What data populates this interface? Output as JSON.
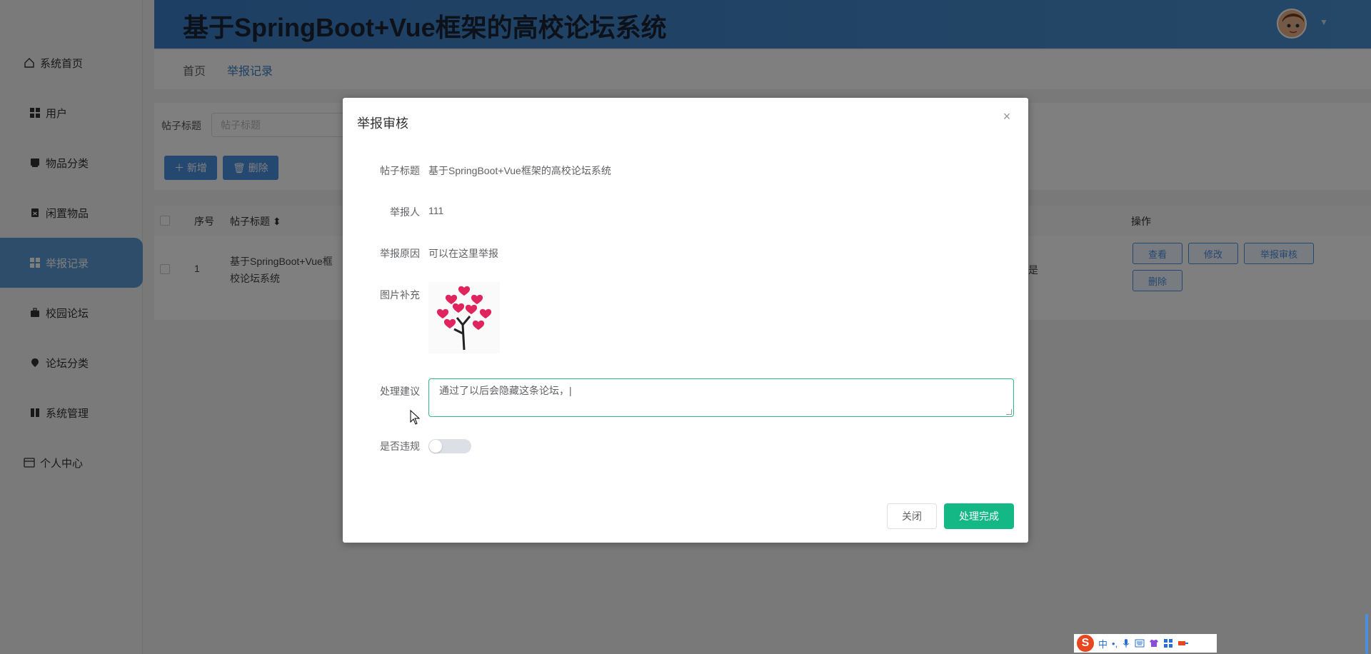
{
  "header": {
    "title": "基于SpringBoot+Vue框架的高校论坛系统",
    "caret": "▼"
  },
  "sidebar": {
    "items": [
      {
        "label": "系统首页",
        "icon": "home-icon"
      },
      {
        "label": "用户",
        "icon": "grid-icon"
      },
      {
        "label": "物品分类",
        "icon": "box-icon"
      },
      {
        "label": "闲置物品",
        "icon": "clipboard-icon"
      },
      {
        "label": "举报记录",
        "icon": "grid-icon",
        "active": true
      },
      {
        "label": "校园论坛",
        "icon": "briefcase-icon"
      },
      {
        "label": "论坛分类",
        "icon": "pin-icon"
      },
      {
        "label": "系统管理",
        "icon": "book-icon"
      },
      {
        "label": "个人中心",
        "icon": "card-icon"
      }
    ]
  },
  "breadcrumb": {
    "home": "首页",
    "current": "举报记录"
  },
  "search": {
    "label": "帖子标题",
    "placeholder": "帖子标题",
    "add_label": "＋ 新增",
    "delete_label": "🗑 删除"
  },
  "table": {
    "headers": {
      "index": "序号",
      "title": "帖子标题 ⬍",
      "ops": "操作"
    },
    "rows": [
      {
        "index": "1",
        "title_line1": "基于SpringBoot+Vue框",
        "title_line2": "校论坛系统",
        "extra": "是",
        "ops": {
          "view": "查看",
          "edit": "修改",
          "review": "举报审核",
          "delete": "删除"
        }
      }
    ]
  },
  "dialog": {
    "title": "举报审核",
    "close_icon": "×",
    "fields": {
      "post_title_label": "帖子标题",
      "post_title_value": "基于SpringBoot+Vue框架的高校论坛系统",
      "reporter_label": "举报人",
      "reporter_value": "111",
      "reason_label": "举报原因",
      "reason_value": "可以在这里举报",
      "image_label": "图片补充",
      "suggestion_label": "处理建议",
      "suggestion_value": "通过了以后会隐藏这条论坛，|",
      "violation_label": "是否违规",
      "violation_on": false
    },
    "buttons": {
      "close": "关闭",
      "done": "处理完成"
    }
  },
  "ime": {
    "logo": "S",
    "lang": "中",
    "punct": "•,",
    "icons": [
      "mic-icon",
      "keyboard-icon",
      "shirt-icon",
      "apps-icon",
      "tool-icon"
    ]
  },
  "colors": {
    "header_bg": "#3a7ec6",
    "accent_blue": "#4a90e2",
    "primary_green": "#14b884",
    "active_menu": "#5b9bd5"
  }
}
